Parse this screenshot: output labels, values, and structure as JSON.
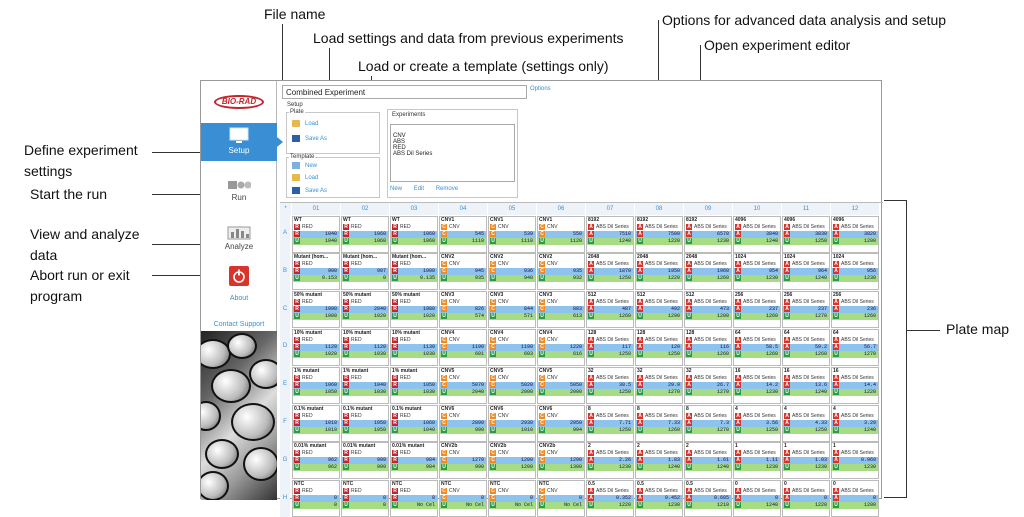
{
  "annotations": {
    "file_name": "File name",
    "load_settings": "Load settings and data from previous experiments",
    "load_template": "Load or create a template (settings only)",
    "options_adv": "Options for advanced data analysis and setup",
    "open_editor": "Open experiment editor",
    "define_settings": "Define experiment settings",
    "start_run": "Start the run",
    "view_analyze": "View and analyze data",
    "abort_run": "Abort run or exit program",
    "plate_map": "Plate map"
  },
  "sidebar": {
    "logo": "BIO-RAD",
    "setup": "Setup",
    "run": "Run",
    "analyze": "Analyze",
    "about": "About",
    "contact": "Contact Support"
  },
  "header": {
    "experiment_name": "Combined Experiment",
    "options": "Options"
  },
  "setup_panel": {
    "setup_label": "Setup",
    "plate_label": "Plate",
    "load": "Load",
    "save_as": "Save As",
    "template_label": "Template",
    "new": "New",
    "t_load": "Load",
    "t_save_as": "Save As"
  },
  "experiments_panel": {
    "label": "Experiments",
    "items": [
      "CNV",
      "ABS",
      "RED",
      "ABS Dil Series"
    ],
    "new": "New",
    "edit": "Edit",
    "remove": "Remove"
  },
  "colors": {
    "accent": "#3a8fd4",
    "red_target": "#c0272d",
    "cnv_target": "#f08a24",
    "abs_target": "#d9342b",
    "u_target": "#2e9a48",
    "val1_bg": "#8ec3ee",
    "val2_bg": "#a6dd84"
  },
  "plate": {
    "corner": "*",
    "columns": [
      "01",
      "02",
      "03",
      "04",
      "05",
      "06",
      "07",
      "08",
      "09",
      "10",
      "11",
      "12"
    ],
    "rows": [
      "A",
      "B",
      "C",
      "D",
      "E",
      "F",
      "G",
      "H"
    ],
    "wells": [
      [
        [
          "WT",
          "R",
          "RED",
          "1040",
          "1040"
        ],
        [
          "WT",
          "R",
          "RED",
          "1060",
          "1060"
        ],
        [
          "WT",
          "R",
          "RED",
          "1060",
          "1060"
        ],
        [
          "CNV1",
          "C",
          "CNV",
          "545",
          "1110"
        ],
        [
          "CNV1",
          "C",
          "CNV",
          "539",
          "1110"
        ],
        [
          "CNV1",
          "C",
          "CNV",
          "550",
          "1120"
        ],
        [
          "8192",
          "A",
          "ABS Dil Series",
          "7510",
          "1240"
        ],
        [
          "8192",
          "A",
          "ABS Dil Series",
          "7500",
          "1220"
        ],
        [
          "8192",
          "A",
          "ABS Dil Series",
          "6570",
          "1230"
        ],
        [
          "4096",
          "A",
          "ABS Dil Series",
          "3840",
          "1240"
        ],
        [
          "4096",
          "A",
          "ABS Dil Series",
          "3830",
          "1250"
        ],
        [
          "4096",
          "A",
          "ABS Dil Series",
          "3820",
          "1200"
        ]
      ],
      [
        [
          "Mutant (hom...",
          "R",
          "RED",
          "900",
          "0.153"
        ],
        [
          "Mutant (hom...",
          "R",
          "RED",
          "907",
          "0"
        ],
        [
          "Mutant (hom...",
          "R",
          "RED",
          "1000",
          "0.135"
        ],
        [
          "CNV2",
          "C",
          "CNV",
          "945",
          "935"
        ],
        [
          "CNV2",
          "C",
          "CNV",
          "936",
          "940"
        ],
        [
          "CNV2",
          "C",
          "CNV",
          "935",
          "932"
        ],
        [
          "2048",
          "A",
          "ABS Dil Series",
          "1870",
          "1250"
        ],
        [
          "2048",
          "A",
          "ABS Dil Series",
          "1950",
          "1220"
        ],
        [
          "2048",
          "A",
          "ABS Dil Series",
          "1960",
          "1260"
        ],
        [
          "1024",
          "A",
          "ABS Dil Series",
          "954",
          "1230"
        ],
        [
          "1024",
          "A",
          "ABS Dil Series",
          "964",
          "1240"
        ],
        [
          "1024",
          "A",
          "ABS Dil Series",
          "956",
          "1230"
        ]
      ],
      [
        [
          "50% mutant",
          "R",
          "RED",
          "1990",
          "1000"
        ],
        [
          "50% mutant",
          "R",
          "RED",
          "2040",
          "1020"
        ],
        [
          "50% mutant",
          "R",
          "RED",
          "1980",
          "1020"
        ],
        [
          "CNV3",
          "C",
          "CNV",
          "826",
          "574"
        ],
        [
          "CNV3",
          "C",
          "CNV",
          "844",
          "571"
        ],
        [
          "CNV3",
          "C",
          "CNV",
          "883",
          "613"
        ],
        [
          "512",
          "A",
          "ABS Dil Series",
          "487",
          "1260"
        ],
        [
          "512",
          "A",
          "ABS Dil Series",
          "492",
          "1290"
        ],
        [
          "512",
          "A",
          "ABS Dil Series",
          "473",
          "1200"
        ],
        [
          "256",
          "A",
          "ABS Dil Series",
          "237",
          "1260"
        ],
        [
          "256",
          "A",
          "ABS Dil Series",
          "237",
          "1270"
        ],
        [
          "256",
          "A",
          "ABS Dil Series",
          "236",
          "1260"
        ]
      ],
      [
        [
          "10% mutant",
          "R",
          "RED",
          "1120",
          "1020"
        ],
        [
          "10% mutant",
          "R",
          "RED",
          "1120",
          "1030"
        ],
        [
          "10% mutant",
          "R",
          "RED",
          "1130",
          "1030"
        ],
        [
          "CNV4",
          "C",
          "CNV",
          "1190",
          "601"
        ],
        [
          "CNV4",
          "C",
          "CNV",
          "1190",
          "603"
        ],
        [
          "CNV4",
          "C",
          "CNV",
          "1220",
          "616"
        ],
        [
          "128",
          "A",
          "ABS Dil Series",
          "117",
          "1250"
        ],
        [
          "128",
          "A",
          "ABS Dil Series",
          "120",
          "1250"
        ],
        [
          "128",
          "A",
          "ABS Dil Series",
          "116",
          "1260"
        ],
        [
          "64",
          "A",
          "ABS Dil Series",
          "58.5",
          "1260"
        ],
        [
          "64",
          "A",
          "ABS Dil Series",
          "59.2",
          "1260"
        ],
        [
          "64",
          "A",
          "ABS Dil Series",
          "56.7",
          "1270"
        ]
      ],
      [
        [
          "1% mutant",
          "R",
          "RED",
          "1060",
          "1050"
        ],
        [
          "1% mutant",
          "R",
          "RED",
          "1040",
          "1030"
        ],
        [
          "1% mutant",
          "R",
          "RED",
          "1050",
          "1030"
        ],
        [
          "CNV5",
          "C",
          "CNV",
          "5070",
          "2040"
        ],
        [
          "CNV5",
          "C",
          "CNV",
          "5020",
          "2000"
        ],
        [
          "CNV5",
          "C",
          "CNV",
          "5050",
          "2000"
        ],
        [
          "32",
          "A",
          "ABS Dil Series",
          "30.5",
          "1250"
        ],
        [
          "32",
          "A",
          "ABS Dil Series",
          "29.9",
          "1270"
        ],
        [
          "32",
          "A",
          "ABS Dil Series",
          "26.7",
          "1270"
        ],
        [
          "16",
          "A",
          "ABS Dil Series",
          "14.2",
          "1230"
        ],
        [
          "16",
          "A",
          "ABS Dil Series",
          "13.6",
          "1240"
        ],
        [
          "16",
          "A",
          "ABS Dil Series",
          "14.4",
          "1220"
        ]
      ],
      [
        [
          "0.1% mutant",
          "R",
          "RED",
          "1010",
          "1010"
        ],
        [
          "0.1% mutant",
          "R",
          "RED",
          "1050",
          "1050"
        ],
        [
          "0.1% mutant",
          "R",
          "RED",
          "1060",
          "1040"
        ],
        [
          "CNV6",
          "C",
          "CNV",
          "2890",
          "990"
        ],
        [
          "CNV6",
          "C",
          "CNV",
          "2930",
          "1010"
        ],
        [
          "CNV6",
          "C",
          "CNV",
          "2950",
          "994"
        ],
        [
          "8",
          "A",
          "ABS Dil Series",
          "7.71",
          "1250"
        ],
        [
          "8",
          "A",
          "ABS Dil Series",
          "7.33",
          "1260"
        ],
        [
          "8",
          "A",
          "ABS Dil Series",
          "7.3",
          "1270"
        ],
        [
          "4",
          "A",
          "ABS Dil Series",
          "3.56",
          "1250"
        ],
        [
          "4",
          "A",
          "ABS Dil Series",
          "4.33",
          "1250"
        ],
        [
          "4",
          "A",
          "ABS Dil Series",
          "3.29",
          "1240"
        ]
      ],
      [
        [
          "0.01% mutant",
          "R",
          "RED",
          "962",
          "962"
        ],
        [
          "0.01% mutant",
          "R",
          "RED",
          "999",
          "999"
        ],
        [
          "0.01% mutant",
          "R",
          "RED",
          "984",
          "984"
        ],
        [
          "CNV2b",
          "C",
          "CNV",
          "1270",
          "990"
        ],
        [
          "CNV2b",
          "C",
          "CNV",
          "1200",
          "1200"
        ],
        [
          "CNV2b",
          "C",
          "CNV",
          "1290",
          "1300"
        ],
        [
          "2",
          "A",
          "ABS Dil Series",
          "2.26",
          "1230"
        ],
        [
          "2",
          "A",
          "ABS Dil Series",
          "1.83",
          "1240"
        ],
        [
          "2",
          "A",
          "ABS Dil Series",
          "1.61",
          "1240"
        ],
        [
          "1",
          "A",
          "ABS Dil Series",
          "1.11",
          "1230"
        ],
        [
          "1",
          "A",
          "ABS Dil Series",
          "1.03",
          "1230"
        ],
        [
          "1",
          "A",
          "ABS Dil Series",
          "0.969",
          "1230"
        ]
      ],
      [
        [
          "NTC",
          "R",
          "RED",
          "0",
          "0"
        ],
        [
          "NTC",
          "R",
          "RED",
          "0",
          "0"
        ],
        [
          "NTC",
          "R",
          "RED",
          "0",
          "No Cel"
        ],
        [
          "NTC",
          "C",
          "CNV",
          "0",
          "No Cel"
        ],
        [
          "NTC",
          "C",
          "CNV",
          "0",
          "No Cel"
        ],
        [
          "NTC",
          "C",
          "CNV",
          "0",
          "No Cel"
        ],
        [
          "0.5",
          "A",
          "ABS Dil Series",
          "0.352",
          "1220"
        ],
        [
          "0.5",
          "A",
          "ABS Dil Series",
          "0.452",
          "1230"
        ],
        [
          "0.5",
          "A",
          "ABS Dil Series",
          "0.605",
          "1210"
        ],
        [
          "0",
          "A",
          "ABS Dil Series",
          "0",
          "1240"
        ],
        [
          "0",
          "A",
          "ABS Dil Series",
          "0",
          "1220"
        ],
        [
          "0",
          "A",
          "ABS Dil Series",
          "0",
          "1200"
        ]
      ]
    ]
  }
}
